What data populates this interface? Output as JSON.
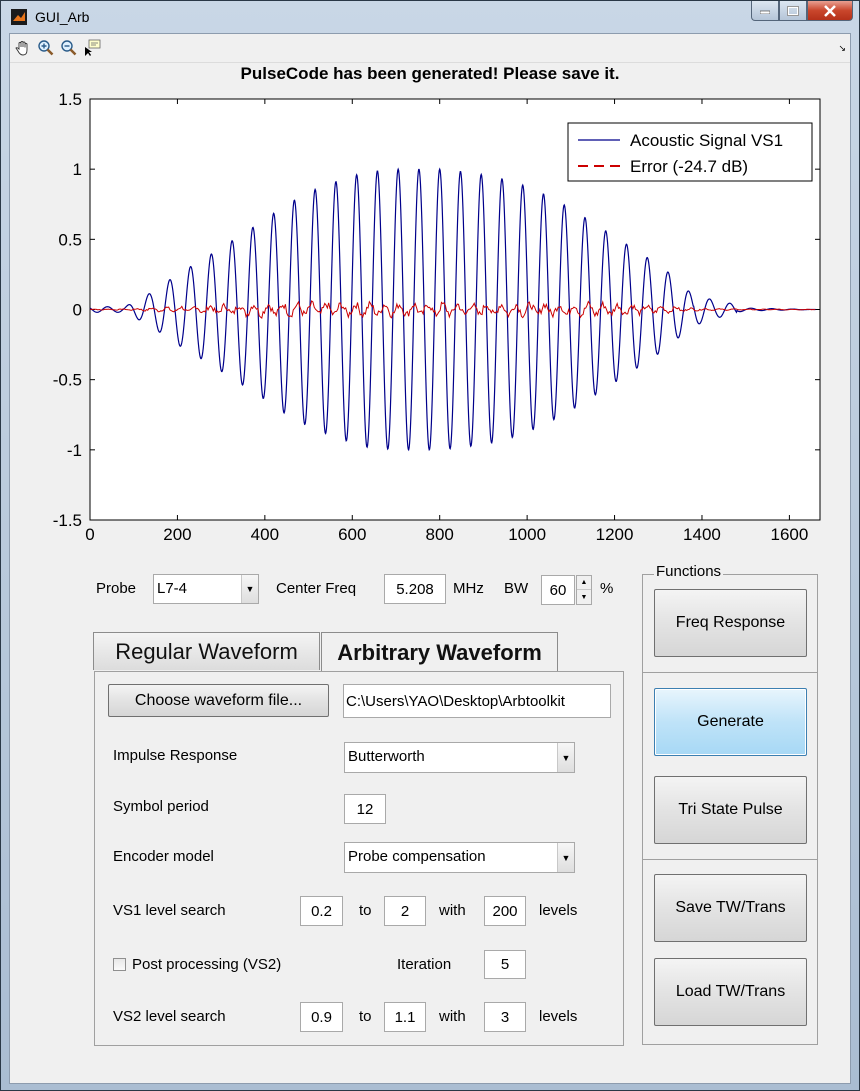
{
  "window": {
    "title": "GUI_Arb",
    "controls": [
      "minimize",
      "maximize",
      "close"
    ]
  },
  "toolbar": {
    "icons": [
      "hand-pan-icon",
      "zoom-in-icon",
      "zoom-out-icon",
      "data-cursor-icon"
    ]
  },
  "figure": {
    "title": "PulseCode has been generated! Please save it."
  },
  "chart_data": {
    "type": "line",
    "title": "PulseCode has been generated! Please save it.",
    "xlabel": "",
    "ylabel": "",
    "xlim": [
      0,
      1670
    ],
    "ylim": [
      -1.5,
      1.5
    ],
    "xticks": [
      0,
      200,
      400,
      600,
      800,
      1000,
      1200,
      1400,
      1600
    ],
    "xtick_labels": [
      "0",
      "200",
      "400",
      "600",
      "800",
      "1000",
      "1200",
      "1400",
      "1600"
    ],
    "yticks": [
      1.5,
      1,
      0.5,
      0,
      -0.5,
      -1,
      -1.5
    ],
    "ytick_labels": [
      "1.5",
      "1",
      "0.5",
      "0",
      "-0.5",
      "-1",
      "-1.5"
    ],
    "grid": false,
    "legend_position": "top-right",
    "series": [
      {
        "name": "Acoustic Signal VS1",
        "color": "#00008b",
        "style": "solid",
        "envelope_peaks": [
          {
            "x": 80,
            "y": 0.02
          },
          {
            "x": 140,
            "y": 0.12
          },
          {
            "x": 200,
            "y": 0.25
          },
          {
            "x": 270,
            "y": 0.38
          },
          {
            "x": 330,
            "y": 0.5
          },
          {
            "x": 390,
            "y": 0.62
          },
          {
            "x": 450,
            "y": 0.75
          },
          {
            "x": 510,
            "y": 0.85
          },
          {
            "x": 570,
            "y": 0.92
          },
          {
            "x": 630,
            "y": 0.98
          },
          {
            "x": 700,
            "y": 1.0
          },
          {
            "x": 760,
            "y": 1.0
          },
          {
            "x": 800,
            "y": 1.0
          },
          {
            "x": 860,
            "y": 0.98
          },
          {
            "x": 920,
            "y": 0.95
          },
          {
            "x": 980,
            "y": 0.9
          },
          {
            "x": 1040,
            "y": 0.82
          },
          {
            "x": 1100,
            "y": 0.72
          },
          {
            "x": 1160,
            "y": 0.6
          },
          {
            "x": 1220,
            "y": 0.48
          },
          {
            "x": 1280,
            "y": 0.36
          },
          {
            "x": 1330,
            "y": 0.25
          },
          {
            "x": 1380,
            "y": 0.1
          },
          {
            "x": 1430,
            "y": 0.04
          },
          {
            "x": 1500,
            "y": 0.01
          },
          {
            "x": 1660,
            "y": 0.0
          }
        ],
        "cycle_period": 47.5
      },
      {
        "name": "Error (-24.7 dB)",
        "color": "#cc0000",
        "style": "dashed",
        "approx_amplitude": 0.06,
        "x_range": [
          0,
          1660
        ]
      }
    ]
  },
  "controls": {
    "probe_label": "Probe",
    "probe_value": "L7-4",
    "center_freq_label": "Center Freq",
    "center_freq_value": "5.208",
    "center_freq_unit": "MHz",
    "bw_label": "BW",
    "bw_value": "60",
    "bw_unit": "%"
  },
  "tabs": [
    {
      "label": "Regular Waveform",
      "active": false
    },
    {
      "label": "Arbitrary Waveform",
      "active": true
    }
  ],
  "arb_panel": {
    "choose_file_button": "Choose waveform file...",
    "file_path": "C:\\Users\\YAO\\Desktop\\Arbtoolkit",
    "impulse_label": "Impulse Response",
    "impulse_value": "Butterworth",
    "symbol_period_label": "Symbol period",
    "symbol_period_value": "12",
    "encoder_label": "Encoder model",
    "encoder_value": "Probe compensation",
    "vs1_label": "VS1 level search",
    "vs1_from": "0.2",
    "vs1_to_label": "to",
    "vs1_to": "2",
    "vs1_with_label": "with",
    "vs1_levels": "200",
    "vs1_levels_label": "levels",
    "post_processing_label": "Post processing (VS2)",
    "post_processing_checked": false,
    "iteration_label": "Iteration",
    "iteration_value": "5",
    "vs2_label": "VS2 level search",
    "vs2_from": "0.9",
    "vs2_to_label": "to",
    "vs2_to": "1.1",
    "vs2_with_label": "with",
    "vs2_levels": "3",
    "vs2_levels_label": "levels"
  },
  "functions": {
    "group_label": "Functions",
    "freq_response": "Freq Response",
    "generate": "Generate",
    "tri_state": "Tri State Pulse",
    "save": "Save TW/Trans",
    "load": "Load TW/Trans"
  }
}
